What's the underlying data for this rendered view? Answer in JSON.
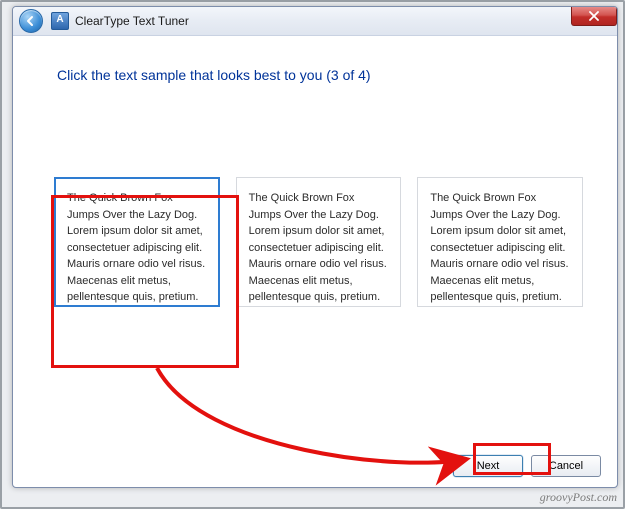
{
  "window": {
    "title": "ClearType Text Tuner",
    "icon_letter": "A"
  },
  "heading": "Click the text sample that looks best to you (3 of 4)",
  "samples": [
    {
      "selected": true,
      "text": "The Quick Brown Fox Jumps Over the Lazy Dog. Lorem ipsum dolor sit amet, consectetuer adipiscing elit. Mauris ornare odio vel risus. Maecenas elit metus, pellentesque quis, pretium."
    },
    {
      "selected": false,
      "text": "The Quick Brown Fox Jumps Over the Lazy Dog. Lorem ipsum dolor sit amet, consectetuer adipiscing elit. Mauris ornare odio vel risus. Maecenas elit metus, pellentesque quis, pretium."
    },
    {
      "selected": false,
      "text": "The Quick Brown Fox Jumps Over the Lazy Dog. Lorem ipsum dolor sit amet, consectetuer adipiscing elit. Mauris ornare odio vel risus. Maecenas elit metus, pellentesque quis, pretium."
    }
  ],
  "buttons": {
    "next": "Next",
    "cancel": "Cancel"
  },
  "watermark": "groovyPost.com",
  "annotation_colors": {
    "highlight": "#e3110e"
  }
}
